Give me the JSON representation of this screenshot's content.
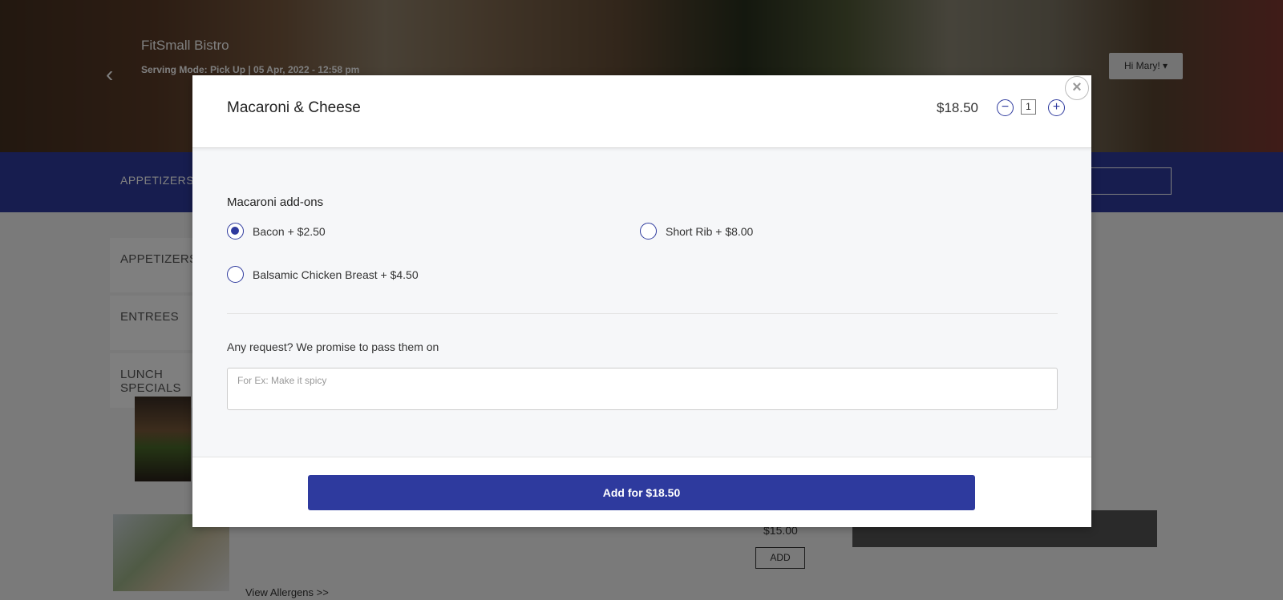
{
  "header": {
    "restaurant_name": "FitSmall Bistro",
    "serving_line": "Serving Mode: Pick Up  |  05 Apr, 2022 - 12:58 pm",
    "user_menu_label": "Hi Mary! ▾"
  },
  "category_bar": {
    "label": "APPETIZERS"
  },
  "side_categories": [
    "APPETIZERS",
    "ENTREES",
    "LUNCH SPECIALS"
  ],
  "background_items": {
    "price": "$15.00",
    "add_label": "ADD",
    "allergens_link": "View Allergens >>"
  },
  "modal": {
    "title": "Macaroni & Cheese",
    "price": "$18.50",
    "quantity": "1",
    "addons_title": "Macaroni add-ons",
    "options": [
      {
        "label": "Bacon + $2.50",
        "checked": true
      },
      {
        "label": "Short Rib + $8.00",
        "checked": false
      },
      {
        "label": "Balsamic Chicken Breast + $4.50",
        "checked": false
      }
    ],
    "request_label": "Any request? We promise to pass them on",
    "request_placeholder": "For Ex: Make it spicy",
    "add_button_label": "Add for $18.50",
    "close_glyph": "×"
  },
  "colors": {
    "accent": "#2e3a9e"
  }
}
